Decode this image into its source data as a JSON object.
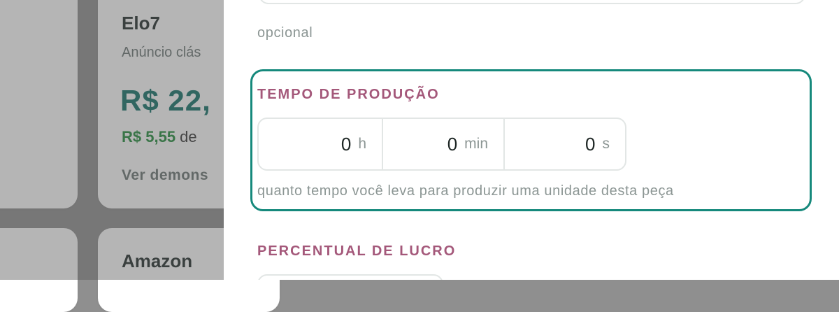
{
  "background": {
    "cards": [
      {
        "title": "Elo7",
        "subtitle": "Anúncio clás",
        "price": "R$ 22,",
        "fee_value": "R$ 5,55",
        "fee_suffix": " de",
        "link": "Ver demons"
      },
      {
        "title": "Amazon"
      }
    ]
  },
  "drawer": {
    "optional_hint": "opcional",
    "production_time": {
      "label": "TEMPO DE PRODUÇÃO",
      "fields": [
        {
          "value": "0",
          "unit": "h"
        },
        {
          "value": "0",
          "unit": "min"
        },
        {
          "value": "0",
          "unit": "s"
        }
      ],
      "hint": "quanto tempo você leva para produzir uma unidade desta peça"
    },
    "profit": {
      "label": "PERCENTUAL DE LUCRO"
    }
  },
  "colors": {
    "accent": "#16897c",
    "section_label": "#a4587a",
    "price": "#0f6f66",
    "fee": "#1f8a3a"
  }
}
